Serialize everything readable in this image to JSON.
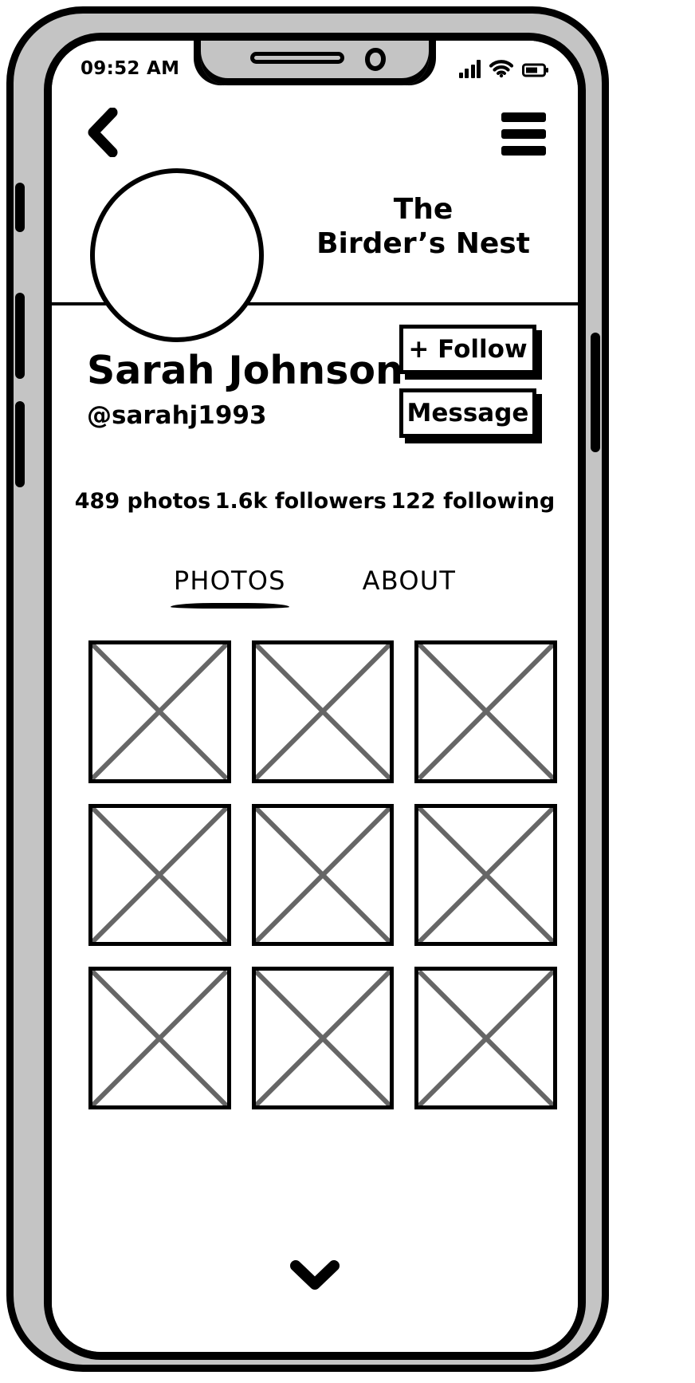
{
  "device": {
    "type": "smartphone-wireframe",
    "frame_color": "#c4c4c4",
    "outline_color": "#000000",
    "screen_background": "#ffffff"
  },
  "status_bar": {
    "time": "09:52 AM",
    "icons": [
      "signal-bars-icon",
      "wifi-icon",
      "battery-icon"
    ],
    "signal_bars": 4,
    "battery_level_pct": 60
  },
  "top_nav": {
    "back_icon": "chevron-left-icon",
    "menu_icon": "hamburger-menu-icon"
  },
  "brand": {
    "title": "The\nBirder’s Nest"
  },
  "profile": {
    "avatar": "avatar-placeholder-circle",
    "name": "Sarah Johnson",
    "handle": "@sarahj1993",
    "follow_label": "+ Follow",
    "message_label": "Message"
  },
  "stats": [
    {
      "label": "489 photos"
    },
    {
      "label": "1.6k followers"
    },
    {
      "label": "122 following"
    }
  ],
  "tabs": [
    {
      "label": "PHOTOS",
      "active": true
    },
    {
      "label": "ABOUT",
      "active": false
    }
  ],
  "photo_grid": {
    "columns": 3,
    "rows": 3,
    "cell_placeholder": "image-placeholder-x",
    "cell_border_color": "#000000",
    "cell_cross_color": "#666666",
    "cells": [
      {
        "index": 1
      },
      {
        "index": 2
      },
      {
        "index": 3
      },
      {
        "index": 4
      },
      {
        "index": 5
      },
      {
        "index": 6
      },
      {
        "index": 7
      },
      {
        "index": 8
      },
      {
        "index": 9
      }
    ]
  },
  "footer": {
    "scroll_icon": "chevron-down-icon"
  },
  "hardware_buttons": [
    {
      "name": "silent-switch"
    },
    {
      "name": "volume-up-button"
    },
    {
      "name": "volume-down-button"
    },
    {
      "name": "power-button"
    }
  ]
}
